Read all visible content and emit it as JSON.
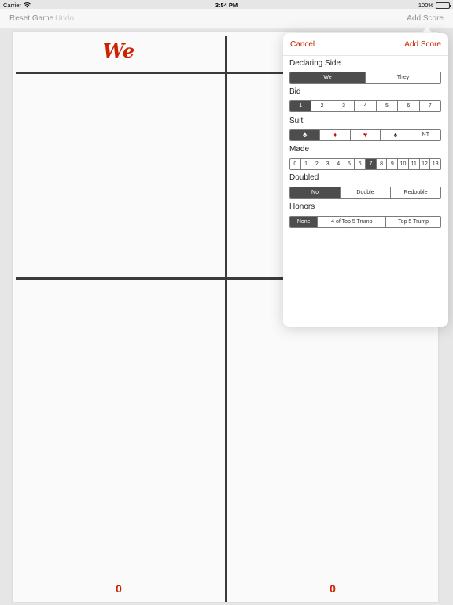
{
  "status": {
    "carrier": "Carrier",
    "time": "3:54 PM",
    "battery": "100%"
  },
  "nav": {
    "reset": "Reset Game",
    "undo": "Undo",
    "add": "Add Score"
  },
  "sheet": {
    "we_title": "We",
    "we_total": "0",
    "they_total": "0"
  },
  "popover": {
    "cancel": "Cancel",
    "add": "Add Score",
    "declaring": {
      "label": "Declaring Side",
      "options": [
        "We",
        "They"
      ],
      "selected": 0
    },
    "bid": {
      "label": "Bid",
      "options": [
        "1",
        "2",
        "3",
        "4",
        "5",
        "6",
        "7"
      ],
      "selected": 0
    },
    "suit": {
      "label": "Suit",
      "options": [
        {
          "icon": "club-icon",
          "glyph": "♣",
          "color": "black"
        },
        {
          "icon": "diamond-icon",
          "glyph": "♦",
          "color": "red"
        },
        {
          "icon": "heart-icon",
          "glyph": "♥",
          "color": "red"
        },
        {
          "icon": "spade-icon",
          "glyph": "♠",
          "color": "black"
        },
        {
          "text": "NT"
        }
      ],
      "selected": 0
    },
    "made": {
      "label": "Made",
      "options": [
        "0",
        "1",
        "2",
        "3",
        "4",
        "5",
        "6",
        "7",
        "8",
        "9",
        "10",
        "11",
        "12",
        "13"
      ],
      "selected": 7
    },
    "doubled": {
      "label": "Doubled",
      "options": [
        "No",
        "Double",
        "Redouble"
      ],
      "selected": 0
    },
    "honors": {
      "label": "Honors",
      "options": [
        "None",
        "4 of Top 5 Trump",
        "Top 5 Trump"
      ],
      "selected": 0
    }
  },
  "colors": {
    "accent": "#cc2200",
    "selected_segment": "#4d4d4d"
  }
}
